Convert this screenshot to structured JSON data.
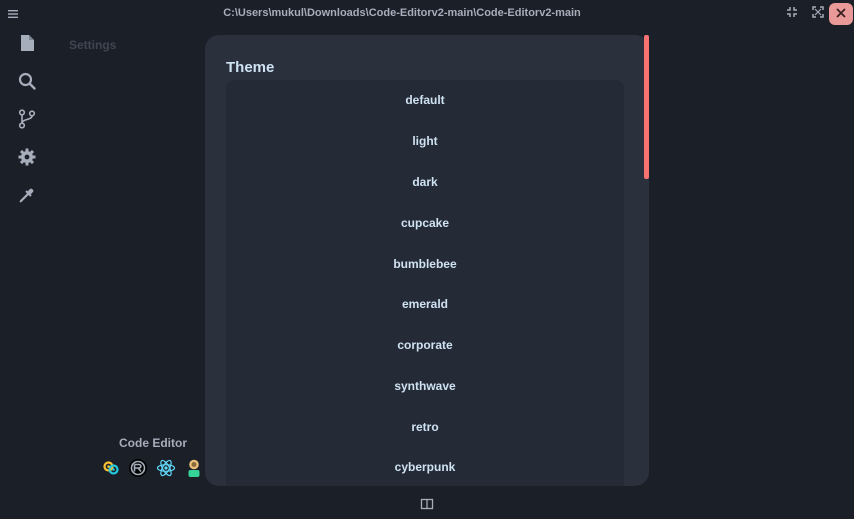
{
  "window": {
    "title": "C:\\Users\\mukul\\Downloads\\Code-Editorv2-main\\Code-Editorv2-main"
  },
  "sidebar": {
    "items": [
      {
        "icon": "file-icon"
      },
      {
        "icon": "search-icon"
      },
      {
        "icon": "git-branch-icon"
      },
      {
        "icon": "gear-icon"
      },
      {
        "icon": "color-picker-icon"
      }
    ]
  },
  "main": {
    "heading": "Settings"
  },
  "footer": {
    "app_name": "Code Editor",
    "tech_icons": [
      "tauri-icon",
      "rust-icon",
      "react-icon",
      "avatar-icon"
    ]
  },
  "theme_modal": {
    "title": "Theme",
    "options": [
      "default",
      "light",
      "dark",
      "cupcake",
      "bumblebee",
      "emerald",
      "corporate",
      "synthwave",
      "retro",
      "cyberpunk"
    ]
  },
  "colors": {
    "background": "#1b1f27",
    "modal": "#2a303c",
    "accent_scrollbar": "#f87272",
    "close_button": "#ea9999"
  }
}
